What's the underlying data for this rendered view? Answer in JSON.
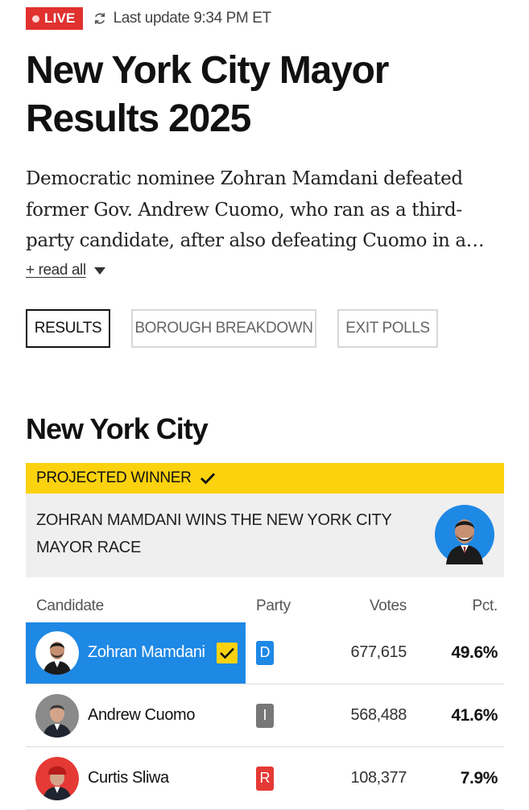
{
  "status": {
    "live_label": "LIVE",
    "update_text": "Last update 9:34 PM ET",
    "refresh_icon": "refresh-icon"
  },
  "headline": {
    "title": "New York City Mayor Results 2025",
    "summary": "Democratic nominee Zohran Mamdani defeated former Gov. Andrew Cuomo, who ran as a third-party candidate, after also defeating Cuomo in a…",
    "read_all_label": "+ read all"
  },
  "tabs": [
    {
      "label": "RESULTS",
      "active": true
    },
    {
      "label": "BOROUGH BREAKDOWN",
      "active": false
    },
    {
      "label": "EXIT POLLS",
      "active": false
    }
  ],
  "section_title": "New York City",
  "winner": {
    "band_label": "PROJECTED WINNER",
    "text": "ZOHRAN MAMDANI WINS THE NEW YORK CITY MAYOR RACE"
  },
  "table": {
    "headers": {
      "candidate": "Candidate",
      "party": "Party",
      "votes": "Votes",
      "pct": "Pct."
    },
    "rows": [
      {
        "name": "Zohran Mamdani",
        "party": "D",
        "votes": "677,615",
        "pct": "49.6%",
        "winner": true
      },
      {
        "name": "Andrew Cuomo",
        "party": "I",
        "votes": "568,488",
        "pct": "41.6%",
        "winner": false
      },
      {
        "name": "Curtis Sliwa",
        "party": "R",
        "votes": "108,377",
        "pct": "7.9%",
        "winner": false
      }
    ]
  },
  "colors": {
    "live_red": "#e0312f",
    "winner_yellow": "#fcd20f",
    "winner_blue": "#1e88e5",
    "dem_blue": "#1e88e5",
    "ind_gray": "#777777",
    "rep_red": "#e53935"
  }
}
